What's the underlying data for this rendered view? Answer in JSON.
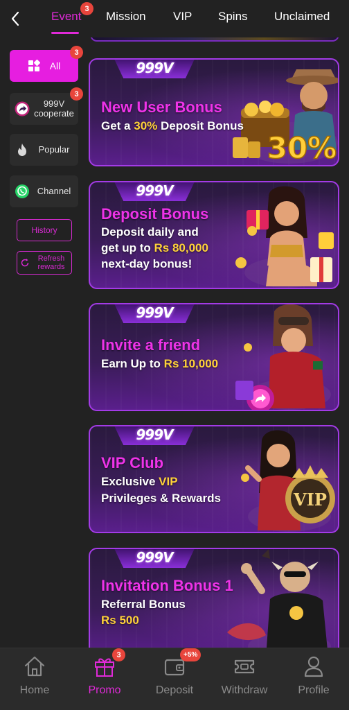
{
  "tabs": [
    {
      "label": "Event",
      "badge": "3",
      "active": true
    },
    {
      "label": "Mission"
    },
    {
      "label": "VIP"
    },
    {
      "label": "Spins"
    },
    {
      "label": "Unclaimed"
    }
  ],
  "sidebar": {
    "items": [
      {
        "label": "All",
        "badge": "3",
        "icon": "grid-icon",
        "active": true
      },
      {
        "label": "999V cooperate",
        "badge": "3",
        "icon": "share-arrow-icon"
      },
      {
        "label": "Popular",
        "icon": "flame-icon"
      },
      {
        "label": "Channel",
        "icon": "whatsapp-icon"
      }
    ],
    "history_label": "History",
    "refresh_label": "Refresh rewards"
  },
  "banners": [
    {
      "logo": "999V",
      "title": "New User Bonus",
      "line1_pre": "Get a ",
      "line1_hl": "30%",
      "line1_post": " Deposit Bonus",
      "art_text": "30%"
    },
    {
      "logo": "999V",
      "title": "Deposit Bonus",
      "line1": "Deposit daily and",
      "line2_pre": "get up to ",
      "line2_hl": "Rs 80,000",
      "line3": "next-day bonus!"
    },
    {
      "logo": "999V",
      "title": "Invite a friend",
      "line1_pre": "Earn Up to ",
      "line1_hl": "Rs 10,000"
    },
    {
      "logo": "999V",
      "title": "VIP Club",
      "line1_pre": "Exclusive ",
      "line1_hl": "VIP",
      "line2": "Privileges & Rewards",
      "art_text": "VIP"
    },
    {
      "logo": "999V",
      "title": "Invitation Bonus 1",
      "line1": "Referral Bonus",
      "line2_hl": "Rs 500"
    }
  ],
  "bottom_nav": [
    {
      "label": "Home",
      "icon": "home-icon"
    },
    {
      "label": "Promo",
      "icon": "gift-icon",
      "badge": "3",
      "active": true
    },
    {
      "label": "Deposit",
      "icon": "wallet-icon",
      "badge": "+5%"
    },
    {
      "label": "Withdraw",
      "icon": "ticket-icon"
    },
    {
      "label": "Profile",
      "icon": "profile-icon"
    }
  ],
  "colors": {
    "accent": "#e02ad8",
    "badge": "#e8453c",
    "highlight": "#ffd23a",
    "background": "#222222"
  }
}
